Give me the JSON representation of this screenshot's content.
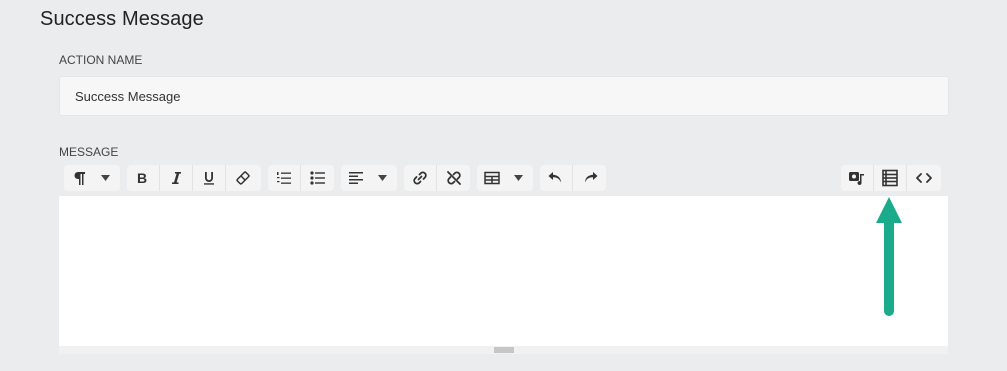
{
  "section": {
    "title": "Success Message"
  },
  "action_name": {
    "label": "ACTION NAME",
    "value": "Success Message"
  },
  "message": {
    "label": "MESSAGE",
    "toolbar": {
      "buttons": [
        "paragraph-style",
        "bold",
        "italic",
        "underline",
        "clear-format",
        "ordered-list",
        "unordered-list",
        "align",
        "link",
        "unlink",
        "table",
        "undo",
        "redo",
        "media",
        "template",
        "code-view"
      ]
    },
    "editor_content": ""
  },
  "annotation": {
    "arrow_color": "#1aab8a",
    "points_to": "template-button"
  }
}
